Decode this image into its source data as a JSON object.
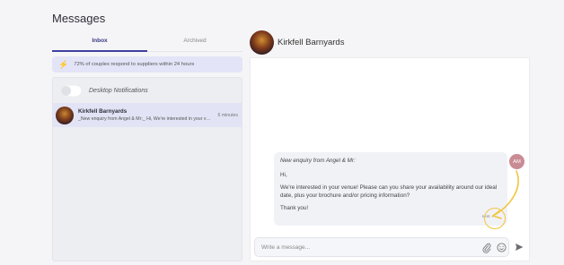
{
  "page": {
    "title": "Messages"
  },
  "tabs": [
    {
      "label": "Inbox",
      "active": true
    },
    {
      "label": "Archived",
      "active": false
    }
  ],
  "stat": {
    "text": "72% of couples respond to suppliers within 24 hours",
    "icon": "bolt-icon"
  },
  "notifications": {
    "label": "Desktop Notifications",
    "enabled": false
  },
  "conversations": [
    {
      "name": "Kirkfell Barnyards",
      "preview": "_New enquiry from Angel & Mr:_ Hi, We're interested in your venue! Please can you share your availability",
      "time": "6 minutes"
    }
  ],
  "chat": {
    "name": "Kirkfell Barnyards",
    "composer_placeholder": "Write a message...",
    "message": {
      "subject": "New enquiry from Angel & Mr:",
      "greeting": "Hi,",
      "body": "We're interested in your venue! Please can you share your availability around our ideal date, plus your brochure and/or pricing information?",
      "signoff": "Thank you!",
      "status": "sent ✓"
    },
    "sender_initials": "AM"
  },
  "colors": {
    "accent": "#3f3fa0",
    "bolt": "#ef7b3a",
    "highlight": "#f2c53d",
    "avatar_me": "#c98b94"
  }
}
